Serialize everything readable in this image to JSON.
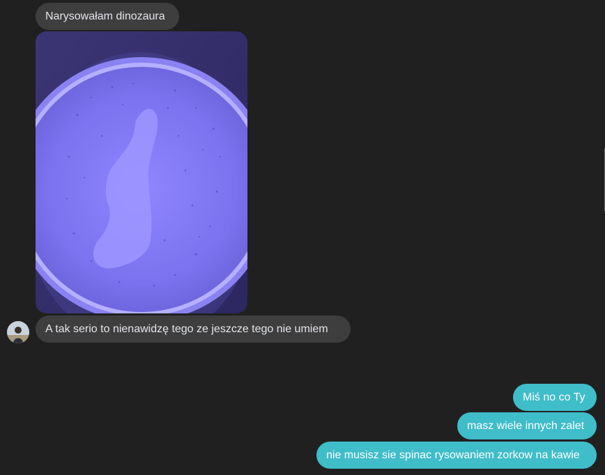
{
  "conversation": {
    "incoming": [
      {
        "text": "Narysowałam dinozaura"
      },
      {
        "text": "A tak serio to nienawidzę tego ze jeszcze tego nie umiem"
      }
    ],
    "outgoing": [
      {
        "text": "Miś no co Ty"
      },
      {
        "text": "masz wiele innych zalet"
      },
      {
        "text": "nie musisz sie spinac rysowaniem zorkow na kawie"
      }
    ]
  },
  "colors": {
    "background": "#202020",
    "incoming_bubble": "#3e3e3e",
    "outgoing_bubble": "#3fbdc9",
    "photo_tint": "#6b63e0"
  },
  "icons": {
    "photo": "latte-art-photo",
    "avatar": "contact-avatar"
  }
}
